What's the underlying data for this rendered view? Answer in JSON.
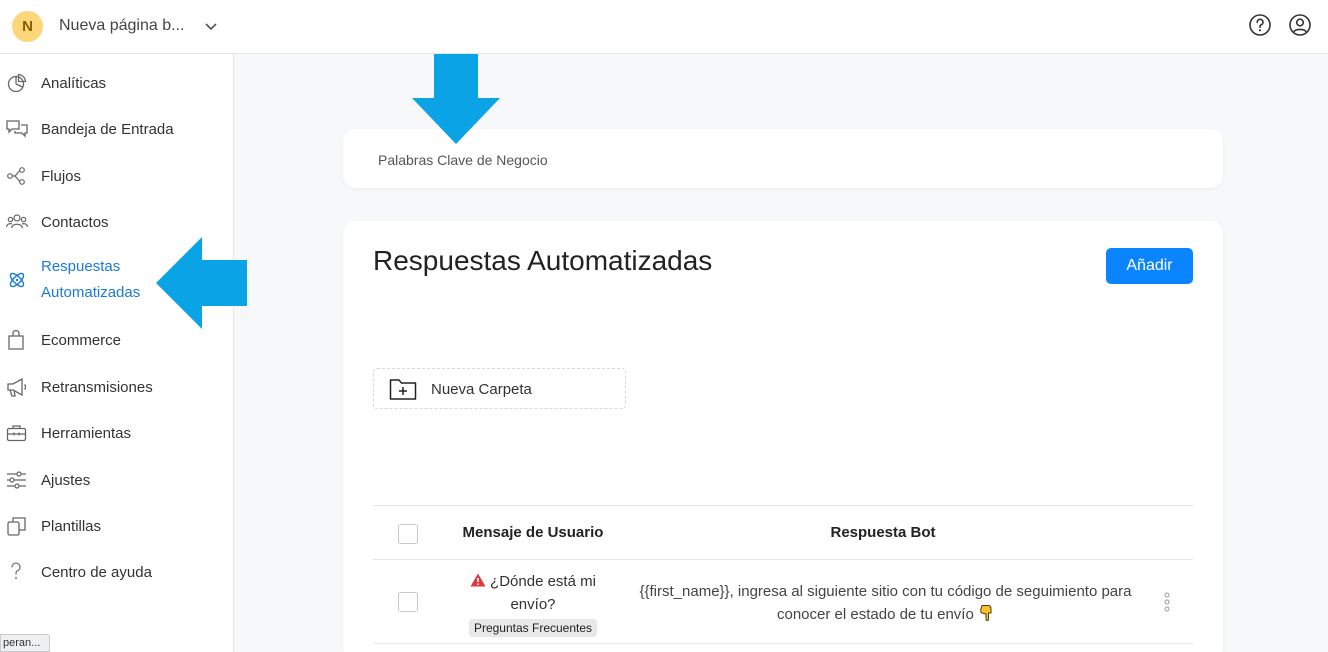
{
  "topbar": {
    "avatar_letter": "N",
    "page_name": "Nueva página b...",
    "icons": [
      "help-icon",
      "user-account-icon"
    ]
  },
  "sidebar": {
    "items": [
      {
        "label": "Analíticas",
        "icon": "analytics-pie-icon"
      },
      {
        "label": "Bandeja de Entrada",
        "icon": "chat-bubbles-icon"
      },
      {
        "label": "Flujos",
        "icon": "flow-nodes-icon"
      },
      {
        "label": "Contactos",
        "icon": "contacts-icon"
      },
      {
        "label": "Respuestas",
        "label2": "Automatizadas",
        "icon": "atom-icon",
        "active": true
      },
      {
        "label": "Ecommerce",
        "icon": "shopping-bag-icon"
      },
      {
        "label": "Retransmisiones",
        "icon": "megaphone-icon"
      },
      {
        "label": "Herramientas",
        "icon": "toolbox-icon"
      },
      {
        "label": "Ajustes",
        "icon": "sliders-icon"
      },
      {
        "label": "Plantillas",
        "icon": "templates-icon"
      },
      {
        "label": "Centro de ayuda",
        "icon": "question-icon"
      }
    ],
    "status_tooltip": "peran..."
  },
  "keywords_card": {
    "label": "Palabras Clave de Negocio"
  },
  "main": {
    "title": "Respuestas Automatizadas",
    "add_label": "Añadir",
    "new_folder_label": "Nueva Carpeta",
    "table": {
      "headers": [
        "Mensaje de Usuario",
        "Respuesta Bot"
      ],
      "rows": [
        {
          "user_message": "¿Dónde está mi envío?",
          "tag": "Preguntas Frecuentes",
          "bot_response": "{{first_name}}, ingresa al siguiente sitio con tu código de seguimiento para conocer el estado de tu envío"
        }
      ]
    }
  },
  "colors": {
    "accent": "#0a84ff",
    "active_nav": "#1a7bd6",
    "tutorial_arrow": "#0aa3e6",
    "avatar_bg": "#fcd77a"
  }
}
